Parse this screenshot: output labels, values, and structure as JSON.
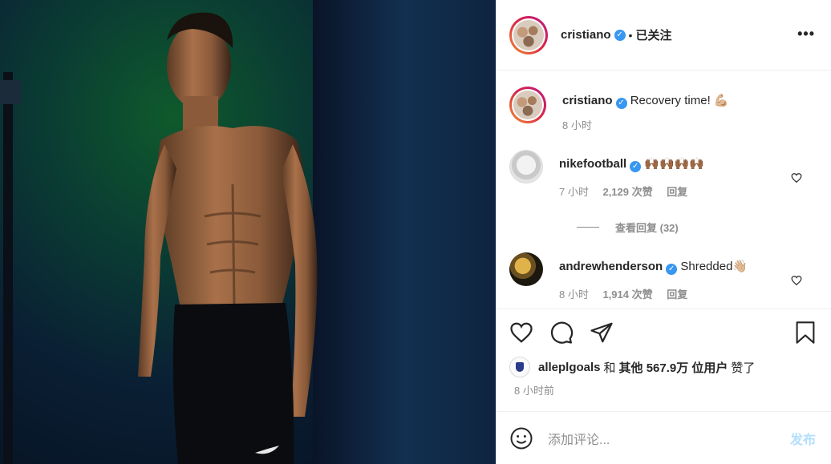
{
  "header": {
    "username": "cristiano",
    "separator": "•",
    "follow_status": "已关注",
    "more_label": "•••"
  },
  "caption": {
    "username": "cristiano",
    "text": "Recovery time! 💪🏼",
    "time": "8 小时"
  },
  "comments": [
    {
      "username": "nikefootball",
      "text": "🙌🏾🙌🏾🙌🏾🙌🏾",
      "time": "7 小时",
      "likes": "2,129 次赞",
      "reply_label": "回复",
      "view_replies": "查看回复 (32)"
    },
    {
      "username": "andrewhenderson",
      "text": "Shredded👋🏼",
      "time": "8 小时",
      "likes": "1,914 次赞",
      "reply_label": "回复"
    }
  ],
  "likes": {
    "user": "alleplgoals",
    "and": "和",
    "others": "其他 567.9万 位用户",
    "suffix": "赞了"
  },
  "post_time": "8 小时前",
  "add_comment": {
    "placeholder": "添加评论...",
    "post_label": "发布"
  },
  "colors": {
    "verified": "#3897f0",
    "post_disabled": "#b2dffc",
    "story_ring": "#dc2743"
  },
  "icons": [
    "heart-icon",
    "comment-icon",
    "share-icon",
    "bookmark-icon",
    "emoji-icon",
    "verified-badge-icon",
    "more-icon"
  ]
}
